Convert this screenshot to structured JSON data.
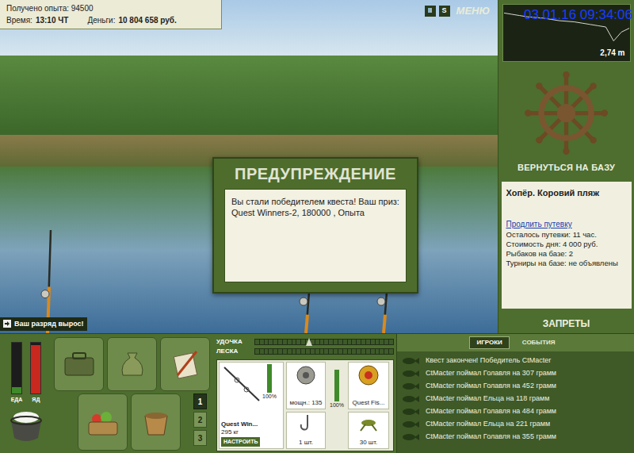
{
  "hud": {
    "experience": "Получено опыта: 94500",
    "time_label": "Время:",
    "time": "13:10 ЧТ",
    "money_label": "Деньги:",
    "money": "10 804 658 руб."
  },
  "top_buttons": [
    {
      "label": "II"
    },
    {
      "label": "S"
    }
  ],
  "menu": "МЕНЮ",
  "timestamp": "03.01.16 09:34:06",
  "depth": {
    "reading": "2,74 m",
    "profile": [
      0.4,
      0.5,
      0.6,
      0.7,
      0.75,
      0.8,
      0.9,
      1.0,
      1.05,
      1.1,
      1.2,
      1.3,
      1.4,
      1.5,
      2.6,
      1.9,
      1.6
    ]
  },
  "base_button": "ВЕРНУТЬСЯ НА БАЗУ",
  "location": {
    "name": "Хопёр. Коровий пляж",
    "extend_link": "Продлить путевку",
    "details": [
      "Осталось путевки: 11 час.",
      "Стоимость дня: 4 000 руб.",
      "Рыбаков на базе: 2",
      "Турниры на базе: не объявлены"
    ]
  },
  "bans_button": "ЗАПРЕТЫ",
  "dialog": {
    "title": "ПРЕДУПРЕЖДЕНИЕ",
    "message": "Вы стали победителем квеста! Ваш приз: Quest Winners-2, 180000 , Опыта"
  },
  "notice": "Ваш разряд вырос!",
  "meters": [
    {
      "label": "ЕДА",
      "level": 0.12,
      "color": "#3f8a2a"
    },
    {
      "label": "ЯД",
      "level": 0.95,
      "color": "#c8281e"
    }
  ],
  "slots": [
    {
      "label": "1",
      "selected": true
    },
    {
      "label": "2",
      "selected": false
    },
    {
      "label": "3",
      "selected": false
    }
  ],
  "tension": [
    {
      "label": "УДОЧКА",
      "level": 0,
      "marker": 0.37
    },
    {
      "label": "ЛЕСКА",
      "level": 0
    }
  ],
  "tackle": {
    "rod": {
      "name": "Quest Win...",
      "weight": "295 кг",
      "level": 1,
      "reading": "100%",
      "button": "НАСТРОИТЬ"
    },
    "reel": {
      "power": "мощн.: 135",
      "level": 1,
      "reading": "100%"
    },
    "line": {
      "name": "Quest Fis..."
    },
    "hook": {
      "count": "1 шт."
    },
    "bait": {
      "count": "30 шт."
    }
  },
  "log": {
    "tabs": [
      {
        "label": "ИГРОКИ",
        "selected": true
      },
      {
        "label": "СОБЫТИЯ",
        "selected": false
      }
    ],
    "entries": [
      "Квест закончен! Победитель CtMacter",
      "CtMacter поймал Голавля на 307 грамм",
      "CtMacter поймал Голавля на 452 грамм",
      "CtMacter поймал Ельца на 118 грамм",
      "CtMacter поймал Голавля на 484 грамм",
      "CtMacter поймал Ельца на 221 грамм",
      "CtMacter поймал Голавля на 355 грамм"
    ]
  }
}
